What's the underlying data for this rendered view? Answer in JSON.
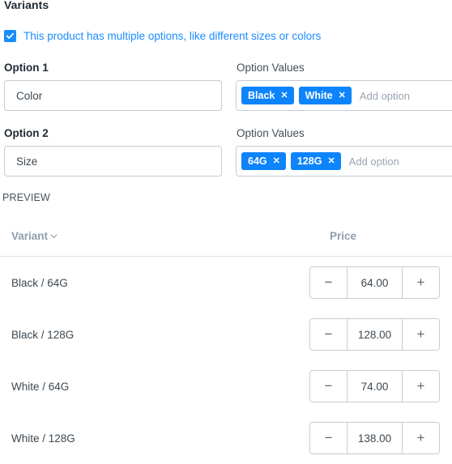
{
  "section": {
    "title": "Variants"
  },
  "multi_options_checkbox": {
    "label": "This product has multiple options, like different sizes or colors",
    "checked": true,
    "accent_color": "#1a8cff"
  },
  "options": [
    {
      "name_label": "Option 1",
      "values_label": "Option Values",
      "name_value": "Color",
      "values": [
        "Black",
        "White"
      ],
      "add_placeholder": "Add option",
      "remove_glyph": "✕"
    },
    {
      "name_label": "Option 2",
      "values_label": "Option Values",
      "name_value": "Size",
      "values": [
        "64G",
        "128G"
      ],
      "add_placeholder": "Add option",
      "remove_glyph": "✕"
    }
  ],
  "preview": {
    "label": "PREVIEW",
    "columns": {
      "variant": "Variant",
      "price": "Price"
    },
    "sort_icon": "chevron-down-icon",
    "rows": [
      {
        "variant": "Black / 64G",
        "price": "64.00"
      },
      {
        "variant": "Black / 128G",
        "price": "128.00"
      },
      {
        "variant": "White / 64G",
        "price": "74.00"
      },
      {
        "variant": "White / 128G",
        "price": "138.00"
      }
    ],
    "stepper": {
      "decrement": "−",
      "increment": "+"
    }
  },
  "colors": {
    "chip_blue": "#0d84fc",
    "link_blue": "#1a8cff",
    "border_gray": "#c4cdd5",
    "header_gray": "#919eab",
    "text_dark": "#212b36"
  }
}
